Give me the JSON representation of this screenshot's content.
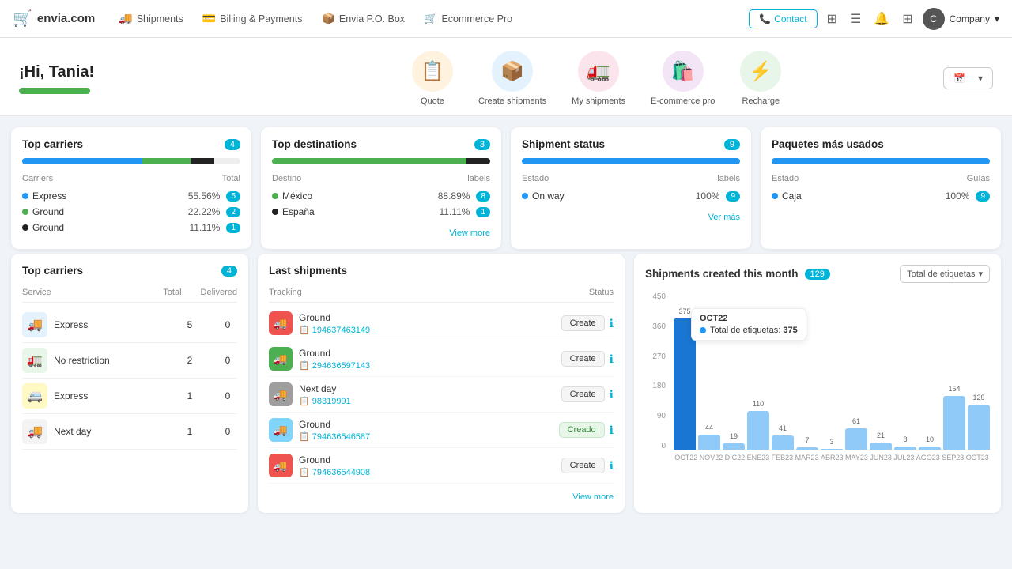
{
  "navbar": {
    "logo_text": "envia.com",
    "links": [
      {
        "label": "Shipments",
        "icon": "🚚"
      },
      {
        "label": "Billing & Payments",
        "icon": "💳"
      },
      {
        "label": "Envia P.O. Box",
        "icon": "📦"
      },
      {
        "label": "Ecommerce Pro",
        "icon": "🛒"
      }
    ],
    "contact_label": "Contact",
    "company_label": "Company"
  },
  "hero": {
    "greeting": "¡Hi, Tania!",
    "icons": [
      {
        "label": "Quote",
        "emoji": "📋",
        "bg": "#fff3e0"
      },
      {
        "label": "Create shipments",
        "emoji": "📦",
        "bg": "#e3f2fd"
      },
      {
        "label": "My shipments",
        "emoji": "🚛",
        "bg": "#fce4ec"
      },
      {
        "label": "E-commerce pro",
        "emoji": "🛍️",
        "bg": "#f3e5f5"
      },
      {
        "label": "Recharge",
        "emoji": "⚡",
        "bg": "#e8f5e9"
      }
    ],
    "date_placeholder": ""
  },
  "top_carriers_1": {
    "title": "Top carriers",
    "badge": "4",
    "progress_segments": [
      {
        "color": "#2196f3",
        "pct": 55
      },
      {
        "color": "#4caf50",
        "pct": 22
      },
      {
        "color": "#222",
        "pct": 11
      },
      {
        "color": "#eee",
        "pct": 12
      }
    ],
    "col_left": "Carriers",
    "col_right": "Total",
    "rows": [
      {
        "dot": "#2196f3",
        "name": "Express",
        "pct": "55.56%",
        "count": "5"
      },
      {
        "dot": "#4caf50",
        "name": "Ground",
        "pct": "22.22%",
        "count": "2"
      },
      {
        "dot": "#222",
        "name": "Ground",
        "pct": "11.11%",
        "count": "1"
      }
    ]
  },
  "top_destinations": {
    "title": "Top destinations",
    "badge": "3",
    "progress_segments": [
      {
        "color": "#4caf50",
        "pct": 89
      },
      {
        "color": "#222",
        "pct": 11
      }
    ],
    "col_left": "Destino",
    "col_right": "labels",
    "rows": [
      {
        "dot": "#4caf50",
        "name": "México",
        "pct": "88.89%",
        "count": "8"
      },
      {
        "dot": "#222",
        "name": "España",
        "pct": "11.11%",
        "count": "1"
      }
    ],
    "view_more": "View more"
  },
  "shipment_status": {
    "title": "Shipment status",
    "badge": "9",
    "progress_segments": [
      {
        "color": "#2196f3",
        "pct": 100
      }
    ],
    "col_left": "Estado",
    "col_right": "labels",
    "rows": [
      {
        "dot": "#2196f3",
        "name": "On way",
        "pct": "100%",
        "count": "9"
      }
    ],
    "view_more": "Ver más"
  },
  "paquetes": {
    "title": "Paquetes más usados",
    "progress_segments": [
      {
        "color": "#2196f3",
        "pct": 100
      }
    ],
    "col_left": "Estado",
    "col_right": "Guías",
    "rows": [
      {
        "dot": "#2196f3",
        "name": "Caja",
        "pct": "100%",
        "count": "9"
      }
    ]
  },
  "top_carriers_2": {
    "title": "Top carriers",
    "badge": "4",
    "col_service": "Service",
    "col_total": "Total",
    "col_delivered": "Delivered",
    "rows": [
      {
        "icon": "🚚",
        "bg": "#e3f2fd",
        "name": "Express",
        "total": "5",
        "delivered": "0"
      },
      {
        "icon": "🚛",
        "bg": "#e8f5e9",
        "name": "No restriction",
        "total": "2",
        "delivered": "0"
      },
      {
        "icon": "🚐",
        "bg": "#fff9c4",
        "name": "Express",
        "total": "1",
        "delivered": "0"
      },
      {
        "icon": "🚚",
        "bg": "#f3f3f3",
        "name": "Next day",
        "total": "1",
        "delivered": "0"
      }
    ]
  },
  "last_shipments": {
    "title": "Last shipments",
    "col_tracking": "Tracking",
    "col_status": "Status",
    "rows": [
      {
        "icon": "🚚",
        "bg": "#ef5350",
        "carrier": "Ground",
        "tracking": "194637463149",
        "status": "Create",
        "creado": false
      },
      {
        "icon": "🚚",
        "bg": "#4caf50",
        "carrier": "Ground",
        "tracking": "294636597143",
        "status": "Create",
        "creado": false
      },
      {
        "icon": "🚚",
        "bg": "#9e9e9e",
        "carrier": "Next day",
        "tracking": "98319991",
        "status": "Create",
        "creado": false
      },
      {
        "icon": "🚚",
        "bg": "#81d4fa",
        "carrier": "Ground",
        "tracking": "794636546587",
        "status": "Creado",
        "creado": true
      },
      {
        "icon": "🚚",
        "bg": "#ef5350",
        "carrier": "Ground",
        "tracking": "794636544908",
        "status": "Create",
        "creado": false
      }
    ],
    "view_more": "View more"
  },
  "shipments_chart": {
    "title": "Shipments created this month",
    "badge": "129",
    "dropdown_label": "Total de etiquetas",
    "tooltip": {
      "month": "OCT22",
      "label": "Total de etiquetas:",
      "value": "375"
    },
    "bars": [
      {
        "month": "OCT22",
        "value": 375,
        "highlight": true
      },
      {
        "month": "NOV22",
        "value": 44
      },
      {
        "month": "DIC22",
        "value": 19
      },
      {
        "month": "ENE23",
        "value": 110
      },
      {
        "month": "FEB23",
        "value": 41
      },
      {
        "month": "MAR23",
        "value": 7
      },
      {
        "month": "ABR23",
        "value": 3
      },
      {
        "month": "MAY23",
        "value": 61
      },
      {
        "month": "JUN23",
        "value": 21
      },
      {
        "month": "JUL23",
        "value": 8
      },
      {
        "month": "AGO23",
        "value": 10
      },
      {
        "month": "SEP23",
        "value": 154
      },
      {
        "month": "OCT23",
        "value": 129
      }
    ],
    "y_labels": [
      "450",
      "360",
      "270",
      "180",
      "90",
      "0"
    ],
    "max_value": 450
  }
}
